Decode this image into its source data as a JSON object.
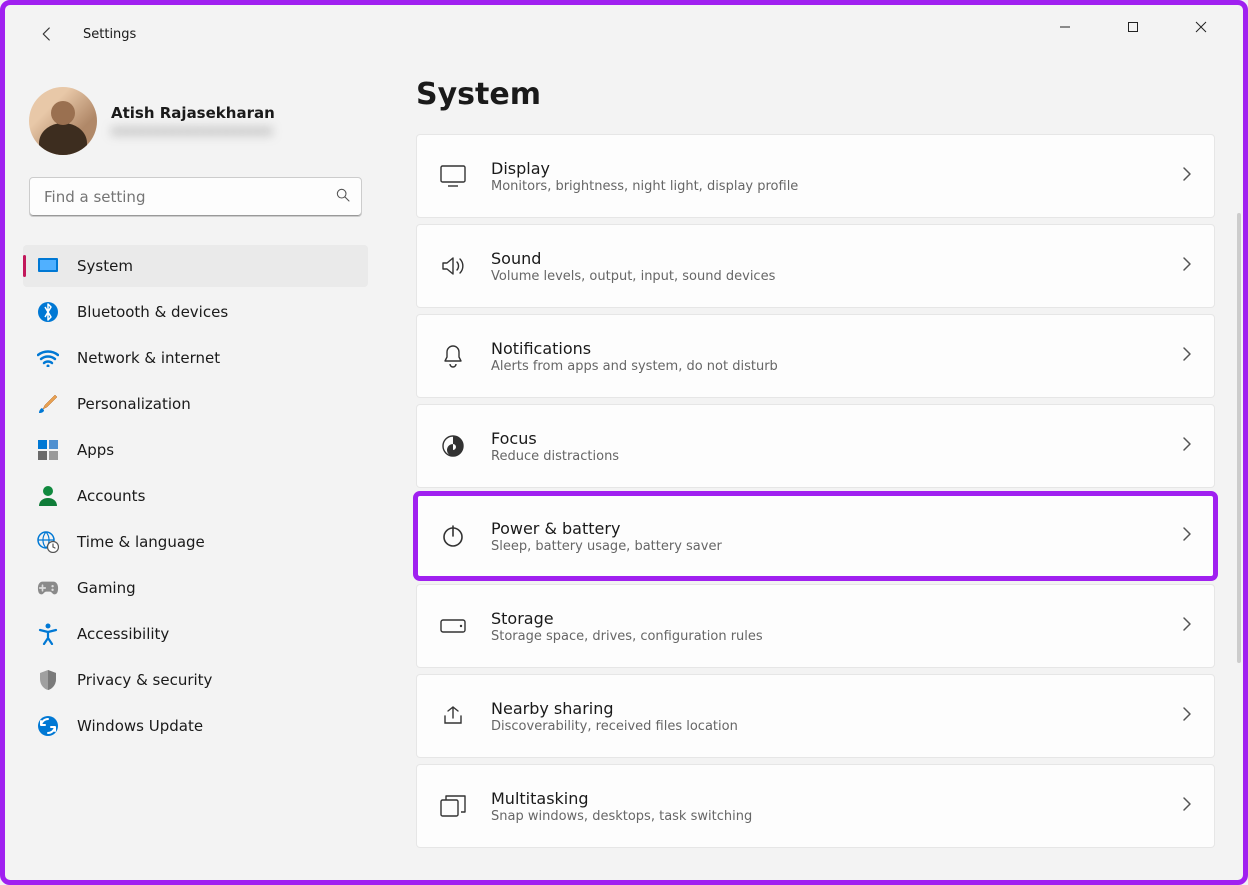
{
  "window": {
    "title": "Settings"
  },
  "profile": {
    "name": "Atish Rajasekharan",
    "email_masked": "xxxxxxxxxxxxxxxxxxxxx"
  },
  "search": {
    "placeholder": "Find a setting"
  },
  "sidebar": {
    "items": [
      {
        "label": "System",
        "icon": "system-icon",
        "active": true
      },
      {
        "label": "Bluetooth & devices",
        "icon": "bluetooth-icon",
        "active": false
      },
      {
        "label": "Network & internet",
        "icon": "wifi-icon",
        "active": false
      },
      {
        "label": "Personalization",
        "icon": "paintbrush-icon",
        "active": false
      },
      {
        "label": "Apps",
        "icon": "apps-icon",
        "active": false
      },
      {
        "label": "Accounts",
        "icon": "person-icon",
        "active": false
      },
      {
        "label": "Time & language",
        "icon": "globe-clock-icon",
        "active": false
      },
      {
        "label": "Gaming",
        "icon": "gamepad-icon",
        "active": false
      },
      {
        "label": "Accessibility",
        "icon": "accessibility-icon",
        "active": false
      },
      {
        "label": "Privacy & security",
        "icon": "shield-icon",
        "active": false
      },
      {
        "label": "Windows Update",
        "icon": "update-icon",
        "active": false
      }
    ]
  },
  "main": {
    "title": "System",
    "cards": [
      {
        "title": "Display",
        "subtitle": "Monitors, brightness, night light, display profile",
        "icon": "display-icon",
        "highlighted": false
      },
      {
        "title": "Sound",
        "subtitle": "Volume levels, output, input, sound devices",
        "icon": "sound-icon",
        "highlighted": false
      },
      {
        "title": "Notifications",
        "subtitle": "Alerts from apps and system, do not disturb",
        "icon": "bell-icon",
        "highlighted": false
      },
      {
        "title": "Focus",
        "subtitle": "Reduce distractions",
        "icon": "focus-icon",
        "highlighted": false
      },
      {
        "title": "Power & battery",
        "subtitle": "Sleep, battery usage, battery saver",
        "icon": "power-icon",
        "highlighted": true
      },
      {
        "title": "Storage",
        "subtitle": "Storage space, drives, configuration rules",
        "icon": "storage-icon",
        "highlighted": false
      },
      {
        "title": "Nearby sharing",
        "subtitle": "Discoverability, received files location",
        "icon": "share-icon",
        "highlighted": false
      },
      {
        "title": "Multitasking",
        "subtitle": "Snap windows, desktops, task switching",
        "icon": "multitask-icon",
        "highlighted": false
      }
    ]
  },
  "colors": {
    "highlight": "#a020f0",
    "accent": "#c2185b",
    "nav_blue": "#0078d4"
  }
}
